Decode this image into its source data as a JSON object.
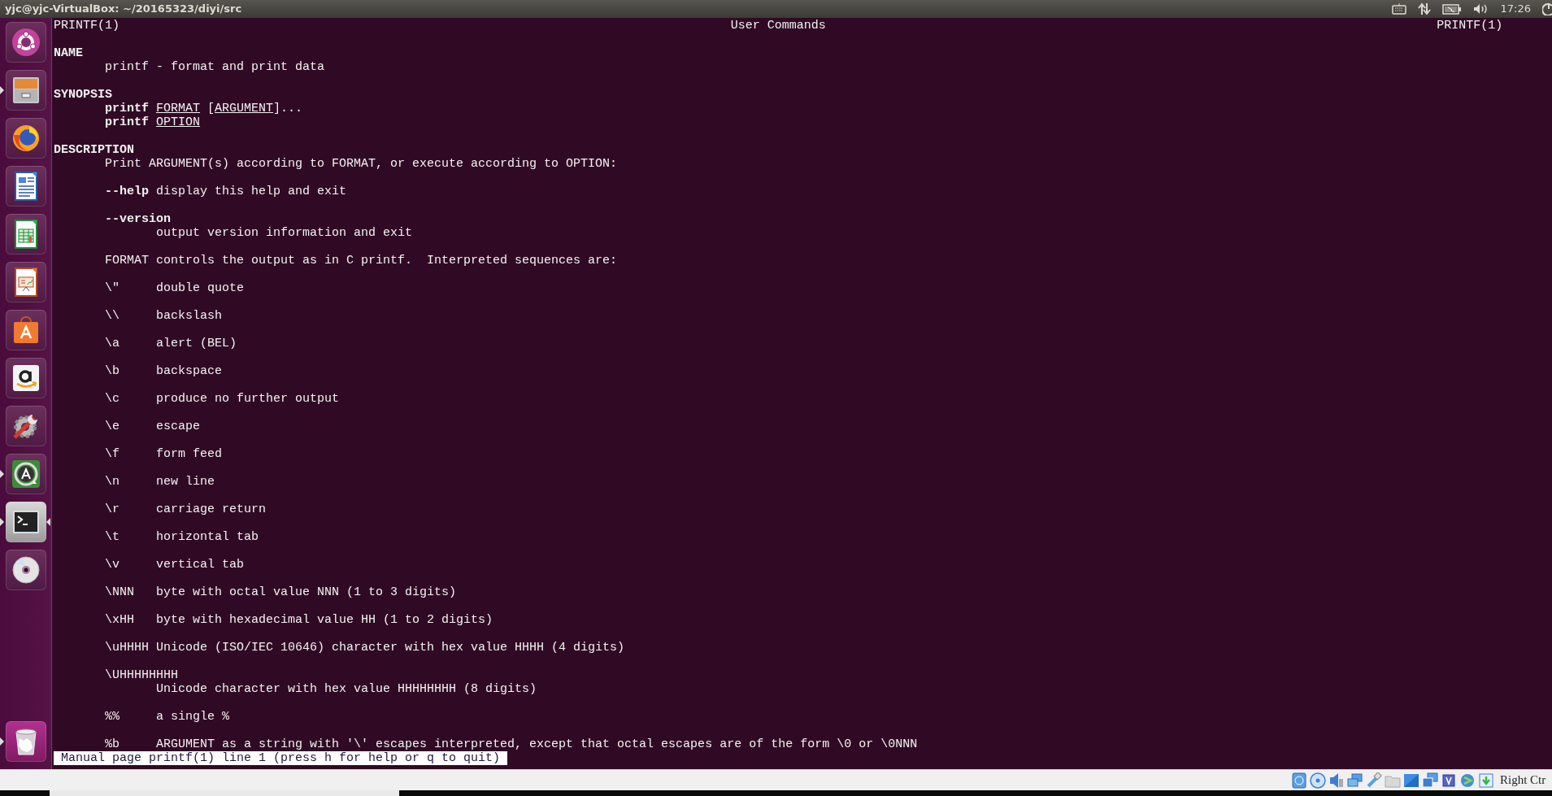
{
  "top_bar": {
    "title": "yjc@yjc-VirtualBox: ~/20165323/diyi/src",
    "clock": "17:26"
  },
  "launcher": {
    "items": [
      {
        "kind": "dash",
        "running": false,
        "selected": false
      },
      {
        "kind": "files",
        "running": true,
        "selected": false
      },
      {
        "kind": "browser",
        "running": false,
        "selected": false
      },
      {
        "kind": "writer",
        "running": false,
        "selected": false
      },
      {
        "kind": "calc",
        "running": false,
        "selected": false
      },
      {
        "kind": "impress",
        "running": false,
        "selected": false
      },
      {
        "kind": "store",
        "running": false,
        "selected": false
      },
      {
        "kind": "amazon",
        "running": false,
        "selected": false
      },
      {
        "kind": "settings",
        "running": false,
        "selected": false
      },
      {
        "kind": "updater",
        "running": true,
        "selected": false
      },
      {
        "kind": "terminal",
        "running": true,
        "selected": true
      },
      {
        "kind": "disc",
        "running": false,
        "selected": false
      }
    ],
    "trash": {
      "running": true
    }
  },
  "man_page": {
    "header": {
      "left": "PRINTF(1)",
      "center": "User Commands",
      "right": "PRINTF(1)"
    },
    "sections": [
      {
        "title": "NAME",
        "blocks": [
          {
            "kind": "para",
            "lines": [
              "printf - format and print data"
            ]
          }
        ]
      },
      {
        "title": "SYNOPSIS",
        "blocks": [
          {
            "kind": "para",
            "lines": [
              "**printf** *FORMAT* [*ARGUMENT*]...",
              "**printf** *OPTION*"
            ]
          }
        ]
      },
      {
        "title": "DESCRIPTION",
        "blocks": [
          {
            "kind": "para",
            "lines": [
              "Print ARGUMENT(s) according to FORMAT, or execute according to OPTION:"
            ]
          },
          {
            "kind": "option",
            "term": "--help",
            "desc": "display this help and exit"
          },
          {
            "kind": "option",
            "term": "--version",
            "desc": "output version information and exit"
          },
          {
            "kind": "para",
            "lines": [
              "FORMAT controls the output as in C printf.  Interpreted sequences are:"
            ]
          },
          {
            "kind": "escape",
            "term": "\\\"",
            "desc": "double quote"
          },
          {
            "kind": "escape",
            "term": "\\\\",
            "desc": "backslash"
          },
          {
            "kind": "escape",
            "term": "\\a",
            "desc": "alert (BEL)"
          },
          {
            "kind": "escape",
            "term": "\\b",
            "desc": "backspace"
          },
          {
            "kind": "escape",
            "term": "\\c",
            "desc": "produce no further output"
          },
          {
            "kind": "escape",
            "term": "\\e",
            "desc": "escape"
          },
          {
            "kind": "escape",
            "term": "\\f",
            "desc": "form feed"
          },
          {
            "kind": "escape",
            "term": "\\n",
            "desc": "new line"
          },
          {
            "kind": "escape",
            "term": "\\r",
            "desc": "carriage return"
          },
          {
            "kind": "escape",
            "term": "\\t",
            "desc": "horizontal tab"
          },
          {
            "kind": "escape",
            "term": "\\v",
            "desc": "vertical tab"
          },
          {
            "kind": "escape",
            "term": "\\NNN",
            "desc": "byte with octal value NNN (1 to 3 digits)"
          },
          {
            "kind": "escape",
            "term": "\\xHH",
            "desc": "byte with hexadecimal value HH (1 to 2 digits)"
          },
          {
            "kind": "escape",
            "term": "\\uHHHH",
            "desc": "Unicode (ISO/IEC 10646) character with hex value HHHH (4 digits)"
          },
          {
            "kind": "escape",
            "term": "\\UHHHHHHHH",
            "desc": "Unicode character with hex value HHHHHHHH (8 digits)"
          },
          {
            "kind": "escape",
            "term": "%%",
            "desc": "a single %"
          },
          {
            "kind": "escape",
            "term": "%b",
            "desc": "ARGUMENT as a string with '\\' escapes interpreted, except that octal escapes are of the form \\0 or \\0NNN"
          }
        ]
      }
    ],
    "prompt": "Manual page printf(1) line 1 (press h for help or q to quit)"
  },
  "vm_status_bar": {
    "host_key": "Right Ctr"
  }
}
